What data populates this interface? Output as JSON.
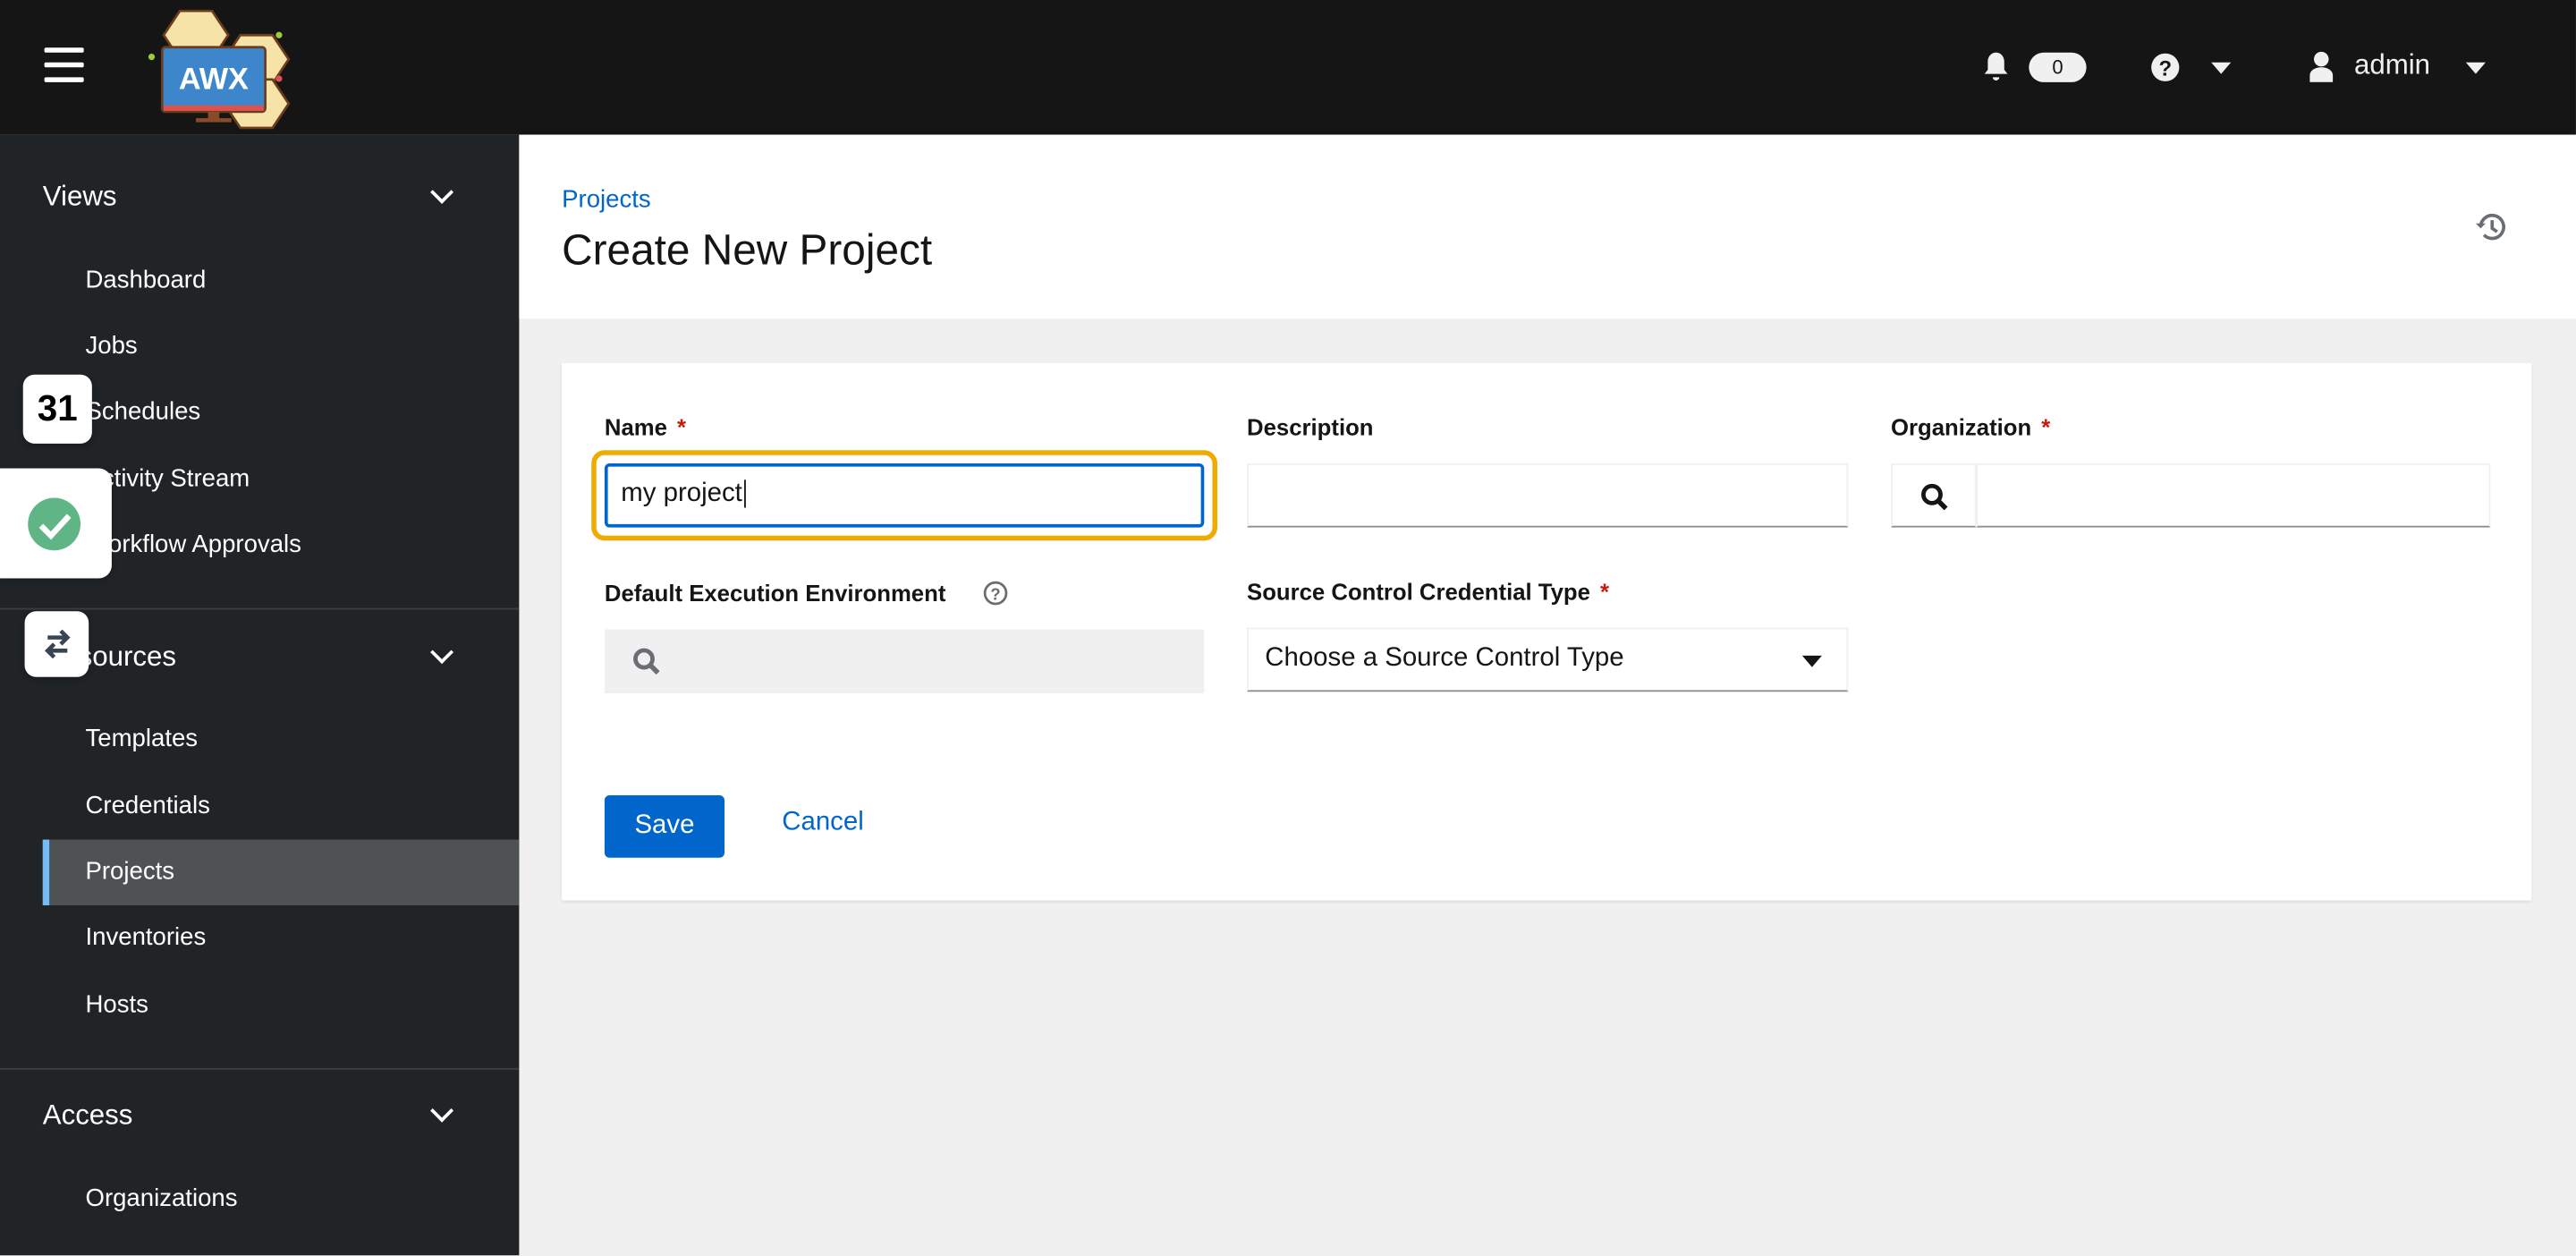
{
  "header": {
    "logo_text": "AWX",
    "notifications_count": "0",
    "user": "admin"
  },
  "sidebar": {
    "groups": [
      {
        "label": "Views",
        "items": [
          "Dashboard",
          "Jobs",
          "Schedules",
          "Activity Stream",
          "Workflow Approvals"
        ]
      },
      {
        "label": "Resources",
        "items": [
          "Templates",
          "Credentials",
          "Projects",
          "Inventories",
          "Hosts"
        ]
      },
      {
        "label": "Access",
        "items": [
          "Organizations"
        ]
      }
    ],
    "active_item": "Projects"
  },
  "floating_widgets": {
    "calendar_day": "31"
  },
  "page": {
    "breadcrumb": "Projects",
    "title": "Create New Project"
  },
  "form": {
    "name": {
      "label": "Name",
      "required": "*",
      "value": "my project"
    },
    "description": {
      "label": "Description",
      "value": ""
    },
    "organization": {
      "label": "Organization",
      "required": "*",
      "value": ""
    },
    "execution_env": {
      "label": "Default Execution Environment",
      "value": ""
    },
    "scm_type": {
      "label": "Source Control Credential Type",
      "required": "*",
      "value": "Choose a Source Control Type"
    },
    "save": "Save",
    "cancel": "Cancel"
  },
  "colors": {
    "primary": "#0066cc",
    "focus_ring": "#f0ab00",
    "header_bg": "#151515",
    "sidebar_bg": "#212427",
    "active_border": "#73bcf7",
    "required": "#c9190b"
  }
}
